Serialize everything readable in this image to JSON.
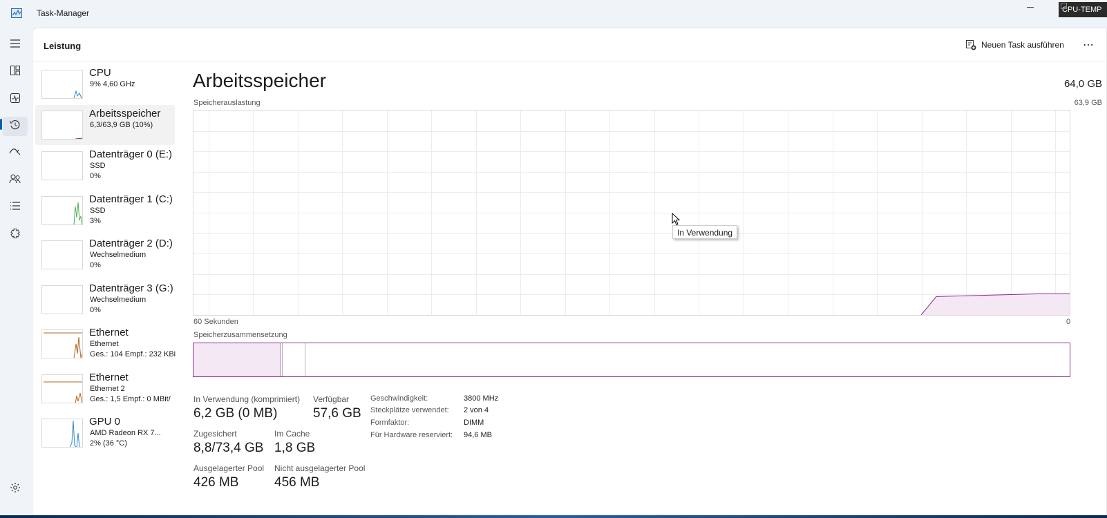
{
  "window": {
    "title": "Task-Manager",
    "badge": "CPU-TEMP"
  },
  "header": {
    "title": "Leistung",
    "run_task_label": "Neuen Task ausführen",
    "more_label": "⋯"
  },
  "nav": {
    "items": [
      {
        "name": "hamburger-menu-icon"
      },
      {
        "name": "processes-icon"
      },
      {
        "name": "performance-icon",
        "active": true
      },
      {
        "name": "app-history-icon"
      },
      {
        "name": "startup-apps-icon"
      },
      {
        "name": "users-icon"
      },
      {
        "name": "details-icon"
      },
      {
        "name": "services-icon"
      }
    ],
    "settings": {
      "name": "settings-gear-icon"
    }
  },
  "devices": [
    {
      "name": "CPU",
      "line2": "9%  4,60 GHz",
      "line3": "",
      "color": "#2b88c8"
    },
    {
      "name": "Arbeitsspeicher",
      "line2": "6,3/63,9 GB (10%)",
      "line3": "",
      "color": "#8b2a8b",
      "selected": true
    },
    {
      "name": "Datenträger 0 (E:)",
      "line2": "SSD",
      "line3": "0%",
      "color": "#4caf50"
    },
    {
      "name": "Datenträger 1 (C:)",
      "line2": "SSD",
      "line3": "3%",
      "color": "#4caf50"
    },
    {
      "name": "Datenträger 2 (D:)",
      "line2": "Wechselmedium",
      "line3": "0%",
      "color": "#4caf50"
    },
    {
      "name": "Datenträger 3 (G:)",
      "line2": "Wechselmedium",
      "line3": "0%",
      "color": "#4caf50"
    },
    {
      "name": "Ethernet",
      "line2": "Ethernet",
      "line3": "Ges.: 104  Empf.: 232 KBi",
      "color": "#b5651d"
    },
    {
      "name": "Ethernet",
      "line2": "Ethernet 2",
      "line3": "Ges.: 1,5  Empf.: 0 MBit/",
      "color": "#b5651d"
    },
    {
      "name": "GPU 0",
      "line2": "AMD Radeon RX 7...",
      "line3": "2%  (36 °C)",
      "color": "#2b88c8"
    }
  ],
  "memory": {
    "title": "Arbeitsspeicher",
    "total": "64,0 GB",
    "usage_label": "Speicherauslastung",
    "graph_max": "63,9 GB",
    "x_left": "60 Sekunden",
    "x_right": "0",
    "composition_label": "Speicherzusammensetzung",
    "tooltip": "In Verwendung",
    "usage_fraction": 0.1,
    "stats": {
      "in_use_label": "In Verwendung (komprimiert)",
      "in_use_value": "6,2 GB (0 MB)",
      "available_label": "Verfügbar",
      "available_value": "57,6 GB",
      "committed_label": "Zugesichert",
      "committed_value": "8,8/73,4 GB",
      "cached_label": "Im Cache",
      "cached_value": "1,8 GB",
      "paged_label": "Ausgelagerter Pool",
      "paged_value": "426 MB",
      "nonpaged_label": "Nicht ausgelagerter Pool",
      "nonpaged_value": "456 MB"
    },
    "specs": [
      {
        "label": "Geschwindigkeit:",
        "value": "3800 MHz"
      },
      {
        "label": "Steckplätze verwendet:",
        "value": "2 von 4"
      },
      {
        "label": "Formfaktor:",
        "value": "DIMM"
      },
      {
        "label": "Für Hardware reserviert:",
        "value": "94,6 MB"
      }
    ]
  },
  "colors": {
    "memory_accent": "#8b2a8b",
    "memory_fill": "#f5e8f5",
    "nav_accent": "#005fb8"
  }
}
